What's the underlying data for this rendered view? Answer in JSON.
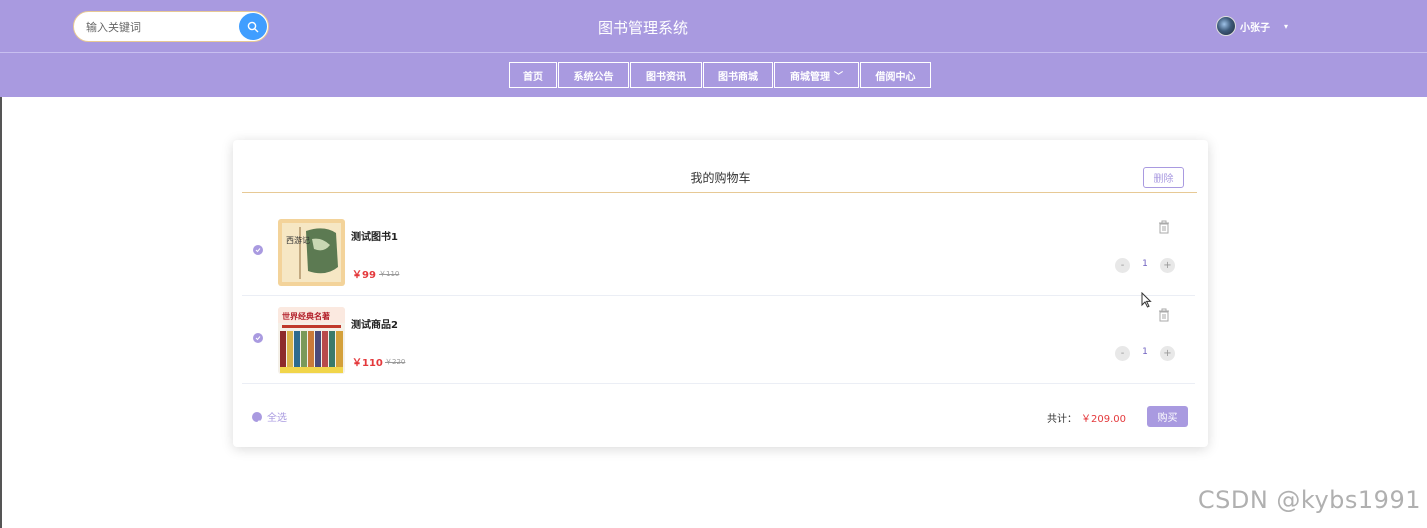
{
  "header": {
    "site_title": "图书管理系统",
    "search": {
      "placeholder": "输入关键词",
      "value": ""
    },
    "user_name": "小张子",
    "accent_color": "#a99ae0"
  },
  "nav": {
    "items": [
      {
        "label": "首页"
      },
      {
        "label": "系统公告"
      },
      {
        "label": "图书资讯"
      },
      {
        "label": "图书商城"
      },
      {
        "label": "商城管理",
        "has_dropdown": true
      },
      {
        "label": "借阅中心"
      }
    ]
  },
  "cart": {
    "title": "我的购物车",
    "delete_label": "删除",
    "items": [
      {
        "name": "测试图书1",
        "price": "￥99",
        "old_price": "￥110",
        "quantity": "1",
        "checked": true,
        "image_icon": "book-cover-xiyouji-icon",
        "cover_text": "西游记"
      },
      {
        "name": "测试商品2",
        "price": "￥110",
        "old_price": "￥220",
        "quantity": "1",
        "checked": true,
        "image_icon": "book-cover-classics-set-icon",
        "cover_text": "世界经典名著"
      }
    ],
    "minus_label": "-",
    "plus_label": "+",
    "select_all_label": "全选",
    "total_label": "共计：",
    "total_value": "￥209.00",
    "buy_label": "购买"
  },
  "watermark": "CSDN @kybs1991",
  "colors": {
    "price": "#e4393c",
    "primary_blue": "#409eff",
    "divider": "#e7c995"
  }
}
